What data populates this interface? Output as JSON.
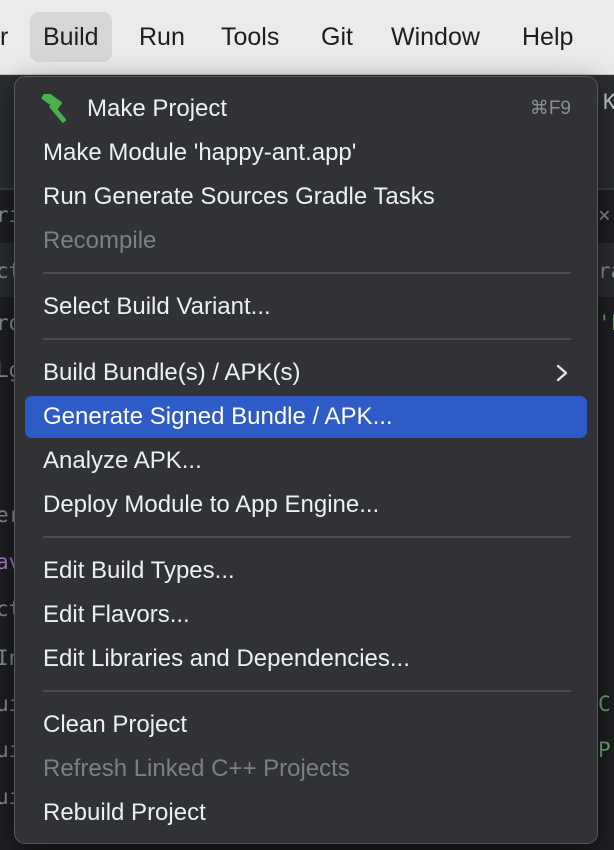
{
  "menubar": {
    "items": [
      {
        "label": "r"
      },
      {
        "label": "Build"
      },
      {
        "label": "Run"
      },
      {
        "label": "Tools"
      },
      {
        "label": "Git"
      },
      {
        "label": "Window"
      },
      {
        "label": "Help"
      }
    ]
  },
  "background_fragments": {
    "left": [
      "ri",
      "ct",
      "ro",
      "Lg",
      "er",
      "av",
      "ct",
      "In",
      "ui",
      "ui",
      "ui"
    ],
    "right": [
      "K",
      "×",
      "ra",
      "'F",
      "C'",
      "P"
    ]
  },
  "build_menu": {
    "items": [
      {
        "label": "Make Project",
        "icon": "hammer-icon",
        "shortcut": "⌘F9",
        "enabled": true
      },
      {
        "label": "Make Module 'happy-ant.app'",
        "enabled": true
      },
      {
        "label": "Run Generate Sources Gradle Tasks",
        "enabled": true
      },
      {
        "label": "Recompile",
        "enabled": false
      },
      {
        "label": "Select Build Variant...",
        "enabled": true
      },
      {
        "label": "Build Bundle(s) / APK(s)",
        "submenu": true,
        "enabled": true
      },
      {
        "label": "Generate Signed Bundle / APK...",
        "selected": true,
        "enabled": true
      },
      {
        "label": "Analyze APK...",
        "enabled": true
      },
      {
        "label": "Deploy Module to App Engine...",
        "enabled": true
      },
      {
        "label": "Edit Build Types...",
        "enabled": true
      },
      {
        "label": "Edit Flavors...",
        "enabled": true
      },
      {
        "label": "Edit Libraries and Dependencies...",
        "enabled": true
      },
      {
        "label": "Clean Project",
        "enabled": true
      },
      {
        "label": "Refresh Linked C++ Projects",
        "enabled": false
      },
      {
        "label": "Rebuild Project",
        "enabled": true
      }
    ]
  },
  "colors": {
    "menu_background": "#313236",
    "selection": "#2f5bc7",
    "menubar": "#ecebea",
    "hammer_icon": "#4caf50"
  }
}
